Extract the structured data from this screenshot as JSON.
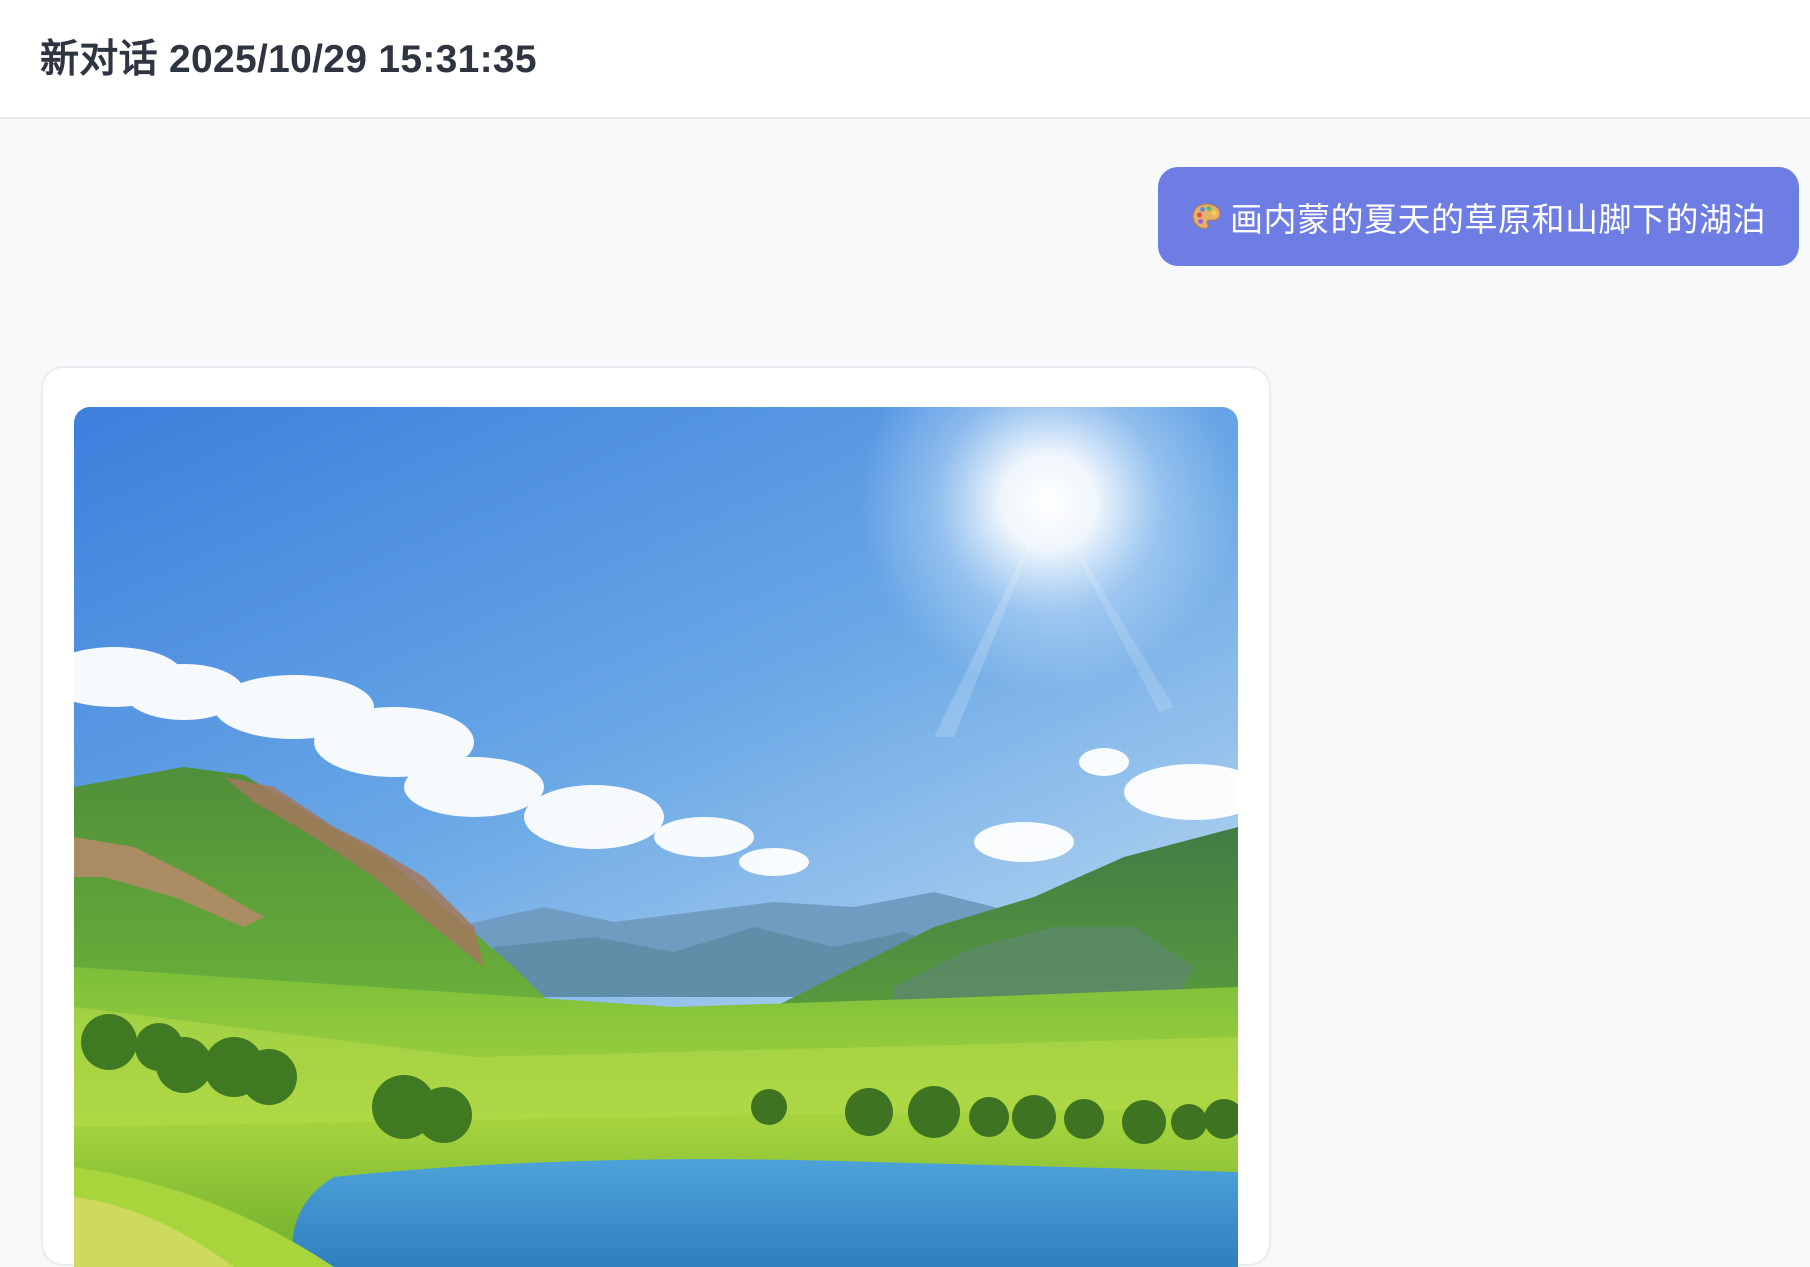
{
  "header": {
    "title": "新对话 2025/10/29 15:31:35"
  },
  "messages": {
    "user": {
      "icon": "palette-icon",
      "text": "画内蒙的夏天的草原和山脚下的湖泊"
    },
    "assistant": {
      "image_description": "generated-landscape-image"
    }
  },
  "colors": {
    "user_bubble": "#6d7de3",
    "page_background": "#f8f9fb",
    "header_background": "#ffffff",
    "title_text": "#2f3441"
  }
}
